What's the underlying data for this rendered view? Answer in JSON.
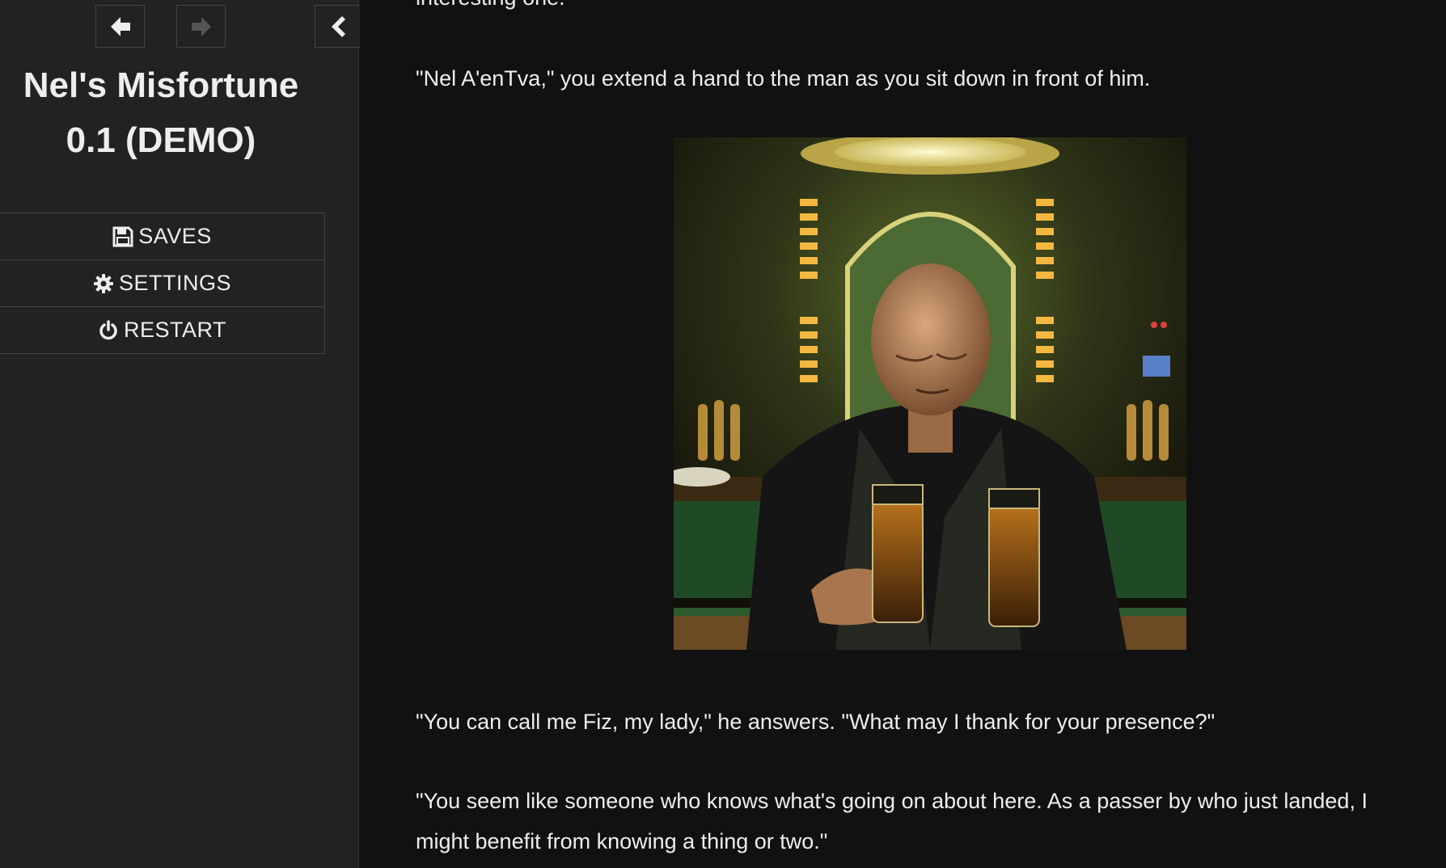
{
  "sidebar": {
    "title": "Nel's Misfortune 0.1 (DEMO)",
    "undo_icon": "arrow-left-icon",
    "redo_icon": "arrow-right-icon",
    "toggle_icon": "chevron-left-icon",
    "menu": [
      {
        "label": "SAVES",
        "icon": "floppy-disk-icon"
      },
      {
        "label": "SETTINGS",
        "icon": "gear-icon"
      },
      {
        "label": "RESTART",
        "icon": "power-icon"
      }
    ]
  },
  "passage": {
    "paragraphs": [
      "interesting one.",
      "\"Nel A'enTva,\" you extend a hand to the man as you sit down in front of him.",
      "\"You can call me Fiz, my lady,\" he answers. \"What may I thank for your presence?\"",
      "\"You seem like someone who knows what's going on about here. As a passer by who just landed, I might benefit from knowing a thing or two.\""
    ]
  },
  "colors": {
    "background": "#111111",
    "sidebar": "#222222",
    "text": "#eeeeee",
    "border": "#444444",
    "disabled": "#555555"
  }
}
